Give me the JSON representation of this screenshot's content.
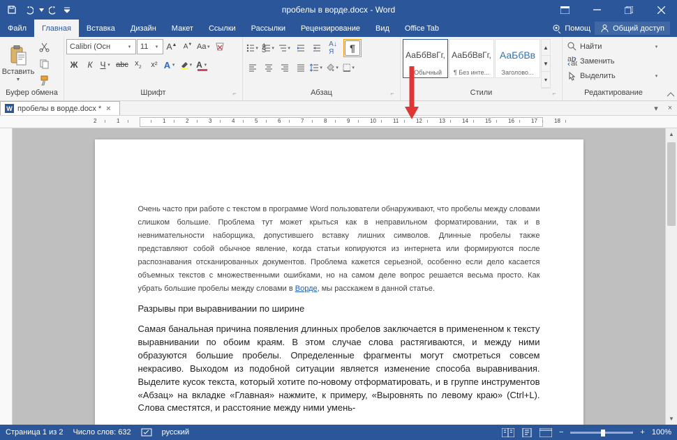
{
  "title": "пробелы в ворде.docx - Word",
  "qat": {
    "save": "save",
    "undo": "undo",
    "redo": "redo"
  },
  "window": {
    "ribbon_opts": "ribbon-display-options",
    "min": "minimize",
    "max": "restore",
    "close": "close"
  },
  "tabs": [
    "Файл",
    "Главная",
    "Вставка",
    "Дизайн",
    "Макет",
    "Ссылки",
    "Рассылки",
    "Рецензирование",
    "Вид",
    "Office Tab"
  ],
  "active_tab": 1,
  "help": "Помощ",
  "share": "Общий доступ",
  "groups": {
    "clipboard": {
      "label": "Буфер обмена",
      "paste": "Вставить"
    },
    "font": {
      "label": "Шрифт",
      "name": "Calibri (Осн",
      "size": "11"
    },
    "paragraph": {
      "label": "Абзац"
    },
    "styles": {
      "label": "Стили",
      "items": [
        {
          "preview": "АаБбВвГг,",
          "name": "¶ Обычный"
        },
        {
          "preview": "АаБбВвГг,",
          "name": "¶ Без инте..."
        },
        {
          "preview": "АаБбВв",
          "name": "Заголово..."
        }
      ]
    },
    "editing": {
      "label": "Редактирование",
      "find": "Найти",
      "replace": "Заменить",
      "select": "Выделить"
    }
  },
  "doc_tab": {
    "name": "пробелы в ворде.docx *"
  },
  "document": {
    "p1_a": "Очень часто при работе с текстом в программе Word пользователи обнаруживают, что пробелы между словами слишком большие. Проблема тут может крыться как в неправильном форматиро­вании, так и в невнимательности наборщика, допустившего вставку лишних символов. Длинные пробелы также представляют собой обычное явление, когда статьи копируются из интернета или формируются после распознавания отсканированных документов. Проблема кажется серьезной, особенно если дело касается объемных текстов с множественными ошибками, но на самом деле вопрос решается весьма просто. Как убрать большие пробелы между словами в ",
    "p1_link": "Ворде",
    "p1_b": ", мы расска­жем в данной статье.",
    "p2": "Разрывы при выравнивании по ширине",
    "p3": "Самая банальная причина появления длинных пробелов заключается в примененном к тексту вы­равнивании по обоим краям. В этом случае слова растягиваются, и между ними образуются боль­шие пробелы. Определенные фрагменты могут смотреться совсем некрасиво. Выходом из подоб­ной ситуации является изменение способа выравнивания. Выделите кусок текста, который хотите по-новому отформатировать, и в группе инструментов «Абзац» на вкладке «Главная» нажмите, к примеру, «Выровнять по левому краю» (Ctrl+L). Слова сместятся, и расстояние между ними умень-"
  },
  "status": {
    "page": "Страница 1 из 2",
    "words": "Число слов: 632",
    "lang": "русский",
    "zoom": "100%"
  }
}
